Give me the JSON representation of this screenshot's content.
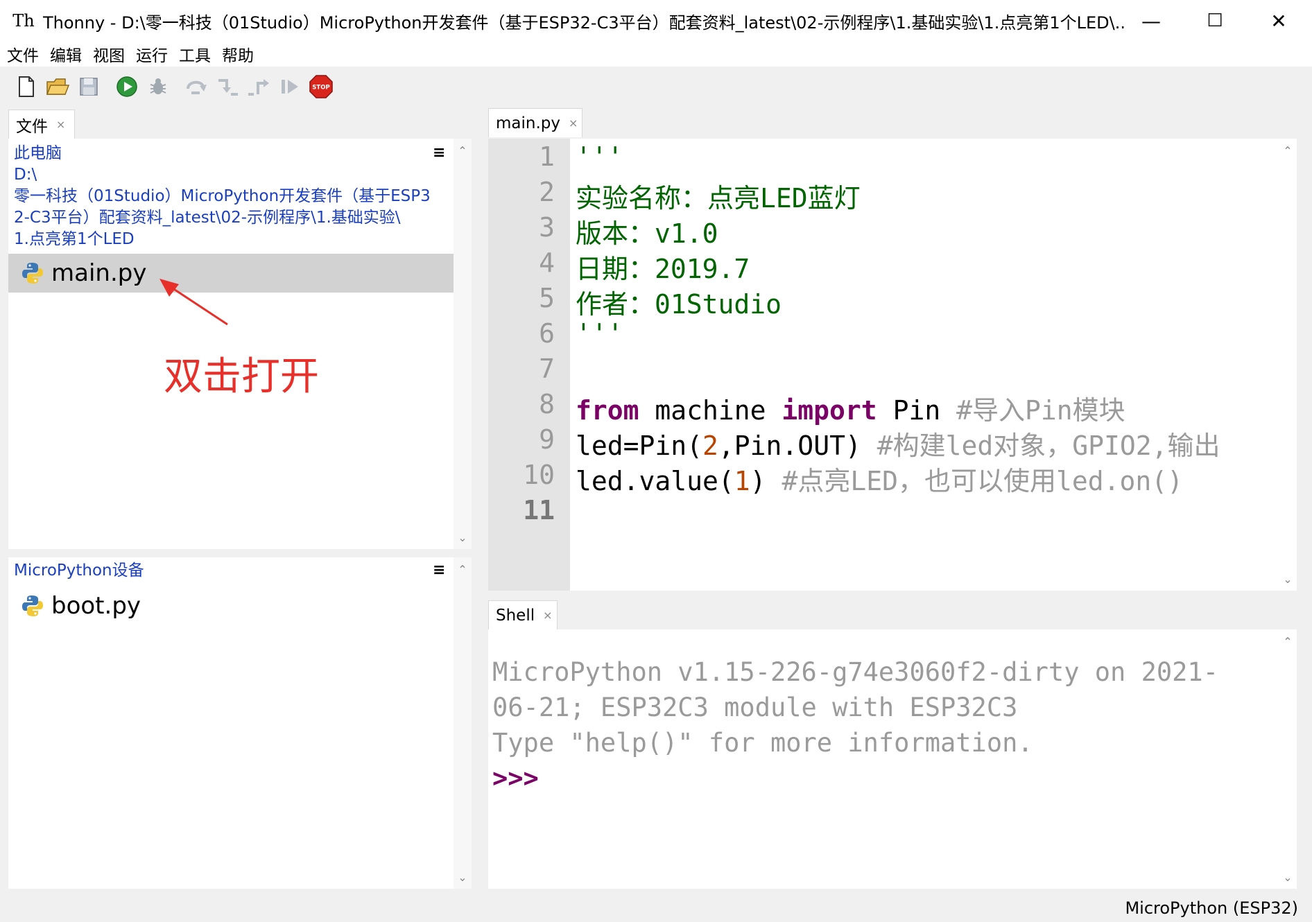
{
  "window": {
    "title": "Thonny  -  D:\\零一科技（01Studio）MicroPython开发套件（基于ESP32-C3平台）配套资料_latest\\02-示例程序\\1.基础实验\\1.点亮第1个LED\\...",
    "app_icon_text": "Th",
    "minimize": "—",
    "maximize": "☐",
    "close": "✕"
  },
  "menu": [
    "文件",
    "编辑",
    "视图",
    "运行",
    "工具",
    "帮助"
  ],
  "toolbar": {
    "icons": [
      "new-file-icon",
      "open-folder-icon",
      "save-icon",
      "run-icon",
      "debug-icon",
      "step-over-icon",
      "step-into-icon",
      "step-out-icon",
      "resume-icon",
      "stop-icon"
    ],
    "stop_label": "STOP"
  },
  "files_panel": {
    "tab_label": "文件",
    "tab_close": "×",
    "this_pc": "此电脑",
    "drive": "D:\\",
    "path_lines": [
      "零一科技（01Studio）MicroPython开发套件（基于ESP3",
      "2-C3平台）配套资料_latest\\02-示例程序\\1.基础实验\\",
      "1.点亮第1个LED"
    ],
    "menu_icon": "≡",
    "files": [
      "main.py"
    ]
  },
  "annotation": "双击打开",
  "device_panel": {
    "title": "MicroPython设备",
    "menu_icon": "≡",
    "files": [
      "boot.py"
    ]
  },
  "editor": {
    "tab_label": "main.py",
    "tab_close": "×",
    "line_numbers": [
      "1",
      "2",
      "3",
      "4",
      "5",
      "6",
      "7",
      "8",
      "9",
      "10",
      "11"
    ],
    "lines": [
      [
        {
          "t": "'''",
          "c": "str"
        }
      ],
      [
        {
          "t": "实验名称：点亮LED蓝灯",
          "c": "str"
        }
      ],
      [
        {
          "t": "版本：v1.0",
          "c": "str"
        }
      ],
      [
        {
          "t": "日期：2019.7",
          "c": "str"
        }
      ],
      [
        {
          "t": "作者：01Studio",
          "c": "str"
        }
      ],
      [
        {
          "t": "'''",
          "c": "str"
        }
      ],
      [],
      [
        {
          "t": "from",
          "c": "kw"
        },
        {
          "t": " machine ",
          "c": "plain"
        },
        {
          "t": "import",
          "c": "kw"
        },
        {
          "t": " Pin ",
          "c": "plain"
        },
        {
          "t": "#导入Pin模块",
          "c": "cmt"
        }
      ],
      [
        {
          "t": "led=Pin(",
          "c": "plain"
        },
        {
          "t": "2",
          "c": "num"
        },
        {
          "t": ",Pin.OUT) ",
          "c": "plain"
        },
        {
          "t": "#构建led对象，GPIO2,输出",
          "c": "cmt"
        }
      ],
      [
        {
          "t": "led.value(",
          "c": "plain"
        },
        {
          "t": "1",
          "c": "num"
        },
        {
          "t": ") ",
          "c": "plain"
        },
        {
          "t": "#点亮LED，也可以使用led.on()",
          "c": "cmt"
        }
      ],
      []
    ]
  },
  "shell": {
    "tab_label": "Shell",
    "tab_close": "×",
    "lines": [
      "MicroPython v1.15-226-g74e3060f2-dirty on 2021-",
      "06-21; ESP32C3 module with ESP32C3",
      "Type \"help()\" for more information."
    ],
    "prompt": ">>>"
  },
  "status": {
    "interpreter": "MicroPython (ESP32)"
  },
  "colors": {
    "string": "#006400",
    "keyword": "#7a0066",
    "number": "#b84400",
    "comment": "#9a9a9a",
    "annotation": "#e8302b",
    "path_link": "#1a3fbf"
  }
}
